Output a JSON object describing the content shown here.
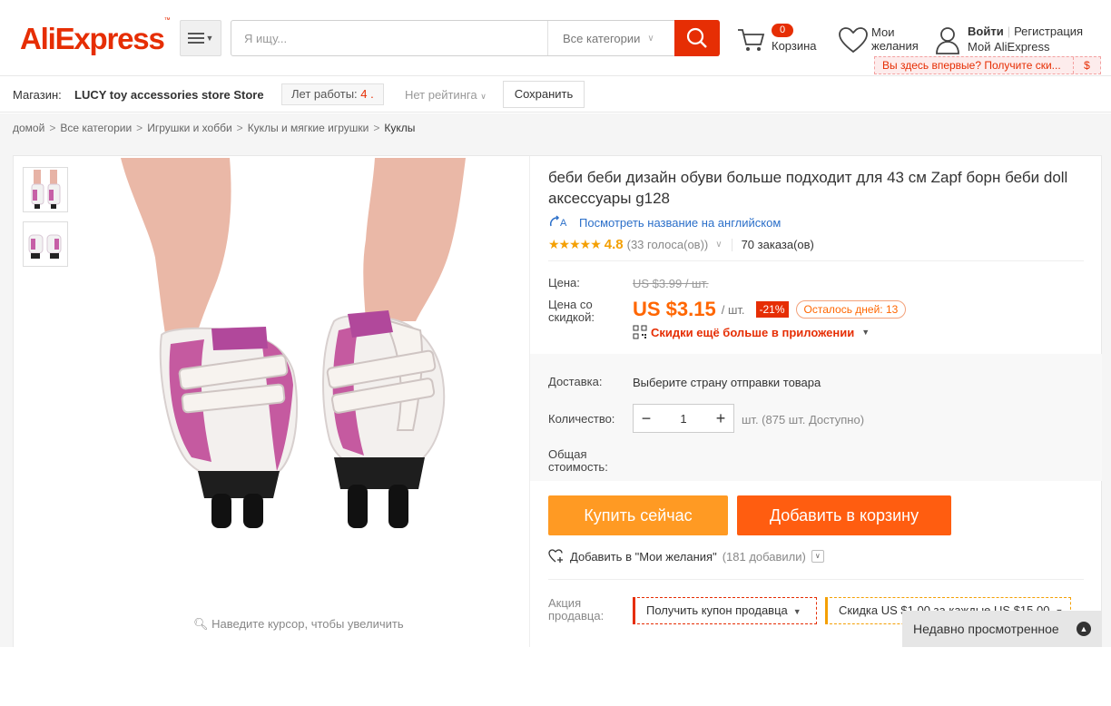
{
  "header": {
    "logo": "AliExpress",
    "logo_tm": "™",
    "search_placeholder": "Я ищу...",
    "category_select": "Все категории",
    "cart_count": "0",
    "cart_label": "Корзина",
    "wishlist_label": "Мои желания",
    "login": "Войти",
    "register": "Регистрация",
    "my_aliexpress": "Мой AliExpress",
    "first_visit": "Вы здесь впервые? Получите ски...",
    "first_visit_currency": "$"
  },
  "store": {
    "label": "Магазин:",
    "name": "LUCY toy accessories store Store",
    "years_label": "Лет работы:",
    "years_value": "4 .",
    "no_rating": "Нет рейтинга",
    "save_button": "Сохранить"
  },
  "breadcrumb": [
    "домой",
    "Все категории",
    "Игрушки и хобби",
    "Куклы и мягкие игрушки",
    "Куклы"
  ],
  "gallery": {
    "zoom_hint": "Наведите курсор, чтобы увеличить"
  },
  "product": {
    "title": "беби беби дизайн обуви больше подходит для 43 см Zapf борн беби doll аксессуары g128",
    "translate_link": "Посмотреть название на английском",
    "rating_stars": "★★★★★",
    "rating": "4.8",
    "votes": "(33 голоса(ов))",
    "orders": "70 заказа(ов)",
    "price_label": "Цена:",
    "old_price": "US $3.99 / шт.",
    "discount_price_label_1": "Цена со",
    "discount_price_label_2": "скидкой:",
    "new_price": "US $3.15",
    "per_unit": "/ шт.",
    "discount": "-21%",
    "days_left": "Осталось дней: 13",
    "app_discount": "Скидки ещё больше в приложении",
    "shipping_label": "Доставка:",
    "shipping_value": "Выберите страну отправки товара",
    "quantity_label": "Количество:",
    "quantity_value": "1",
    "quantity_available": "шт. (875 шт. Доступно)",
    "total_label_1": "Общая",
    "total_label_2": "стоимость:",
    "buy_now": "Купить сейчас",
    "add_to_cart": "Добавить в корзину",
    "add_to_wishlist": "Добавить в \"Мои желания\"",
    "wishlist_count": "(181 добавили)",
    "promo_label_1": "Акция",
    "promo_label_2": "продавца:",
    "coupon": "Получить купон продавца",
    "sale": "Скидка US $1.00 за каждые US $15.00"
  },
  "recent": "Недавно просмотренное",
  "colors": {
    "brand": "#e62e04",
    "orange": "#ff9a23",
    "cart_orange": "#ff5d10",
    "price": "#f60",
    "link": "#2b6fc9"
  }
}
